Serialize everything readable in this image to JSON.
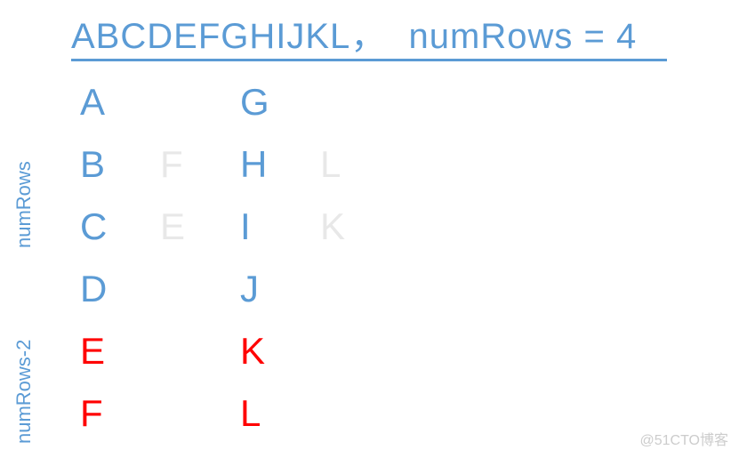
{
  "header": {
    "input_string": "ABCDEFGHIJKL",
    "separator": "，",
    "param": "numRows = 4"
  },
  "sideLabels": {
    "numRows": "numRows",
    "numRowsMinus2": "numRows-2"
  },
  "grid": {
    "rows": [
      [
        {
          "t": "A",
          "c": "blue"
        },
        {
          "t": "",
          "c": ""
        },
        {
          "t": "G",
          "c": "blue"
        },
        {
          "t": "",
          "c": ""
        },
        {
          "t": "",
          "c": ""
        }
      ],
      [
        {
          "t": "B",
          "c": "blue"
        },
        {
          "t": "F",
          "c": "faint"
        },
        {
          "t": "H",
          "c": "blue"
        },
        {
          "t": "L",
          "c": "faint"
        },
        {
          "t": "",
          "c": ""
        }
      ],
      [
        {
          "t": "C",
          "c": "blue"
        },
        {
          "t": "E",
          "c": "faint"
        },
        {
          "t": "I",
          "c": "blue"
        },
        {
          "t": "K",
          "c": "faint"
        },
        {
          "t": "",
          "c": ""
        }
      ],
      [
        {
          "t": "D",
          "c": "blue"
        },
        {
          "t": "",
          "c": ""
        },
        {
          "t": "J",
          "c": "blue"
        },
        {
          "t": "",
          "c": ""
        },
        {
          "t": "",
          "c": ""
        }
      ],
      [
        {
          "t": "E",
          "c": "red"
        },
        {
          "t": "",
          "c": ""
        },
        {
          "t": "K",
          "c": "red"
        },
        {
          "t": "",
          "c": ""
        },
        {
          "t": "",
          "c": ""
        }
      ],
      [
        {
          "t": "F",
          "c": "red"
        },
        {
          "t": "",
          "c": ""
        },
        {
          "t": "L",
          "c": "red"
        },
        {
          "t": "",
          "c": ""
        },
        {
          "t": "",
          "c": ""
        }
      ]
    ]
  },
  "watermark": "@51CTO博客"
}
